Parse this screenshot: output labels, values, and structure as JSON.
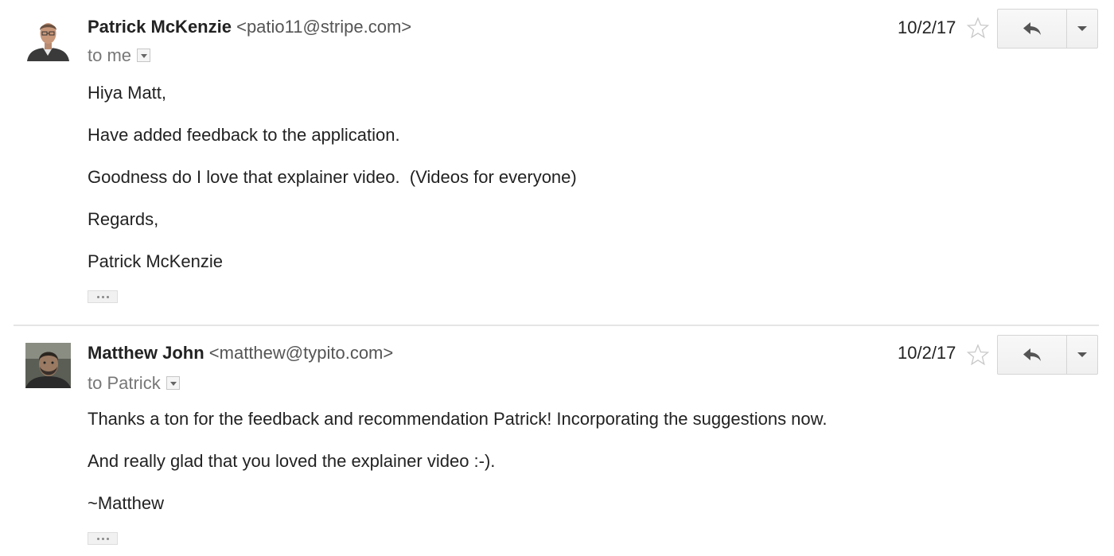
{
  "messages": [
    {
      "sender_name": "Patrick McKenzie",
      "sender_email": "<patio11@stripe.com>",
      "recipient": "to me",
      "date": "10/2/17",
      "body": [
        "Hiya Matt,",
        "Have added feedback to the application.",
        "Goodness do I love that explainer video.  (Videos for everyone)",
        "Regards,",
        "Patrick McKenzie"
      ],
      "avatar_icon": "avatar-photo-icon",
      "star_icon": "star-outline-icon",
      "reply_icon": "reply-arrow-icon",
      "more_icon": "chevron-down-icon",
      "trimmed_icon": "ellipsis-icon"
    },
    {
      "sender_name": "Matthew John",
      "sender_email": "<matthew@typito.com>",
      "recipient": "to Patrick",
      "date": "10/2/17",
      "body": [
        "Thanks a ton for the feedback and recommendation Patrick! Incorporating the suggestions now.",
        "And really glad that you loved the explainer video :-).",
        "~Matthew"
      ],
      "avatar_icon": "avatar-photo-icon",
      "star_icon": "star-outline-icon",
      "reply_icon": "reply-arrow-icon",
      "more_icon": "chevron-down-icon",
      "trimmed_icon": "ellipsis-icon"
    }
  ],
  "colors": {
    "text": "#222222",
    "email": "#555555",
    "recipient": "#777777",
    "divider": "#e5e5e5",
    "button_border": "#d5d5d5"
  }
}
